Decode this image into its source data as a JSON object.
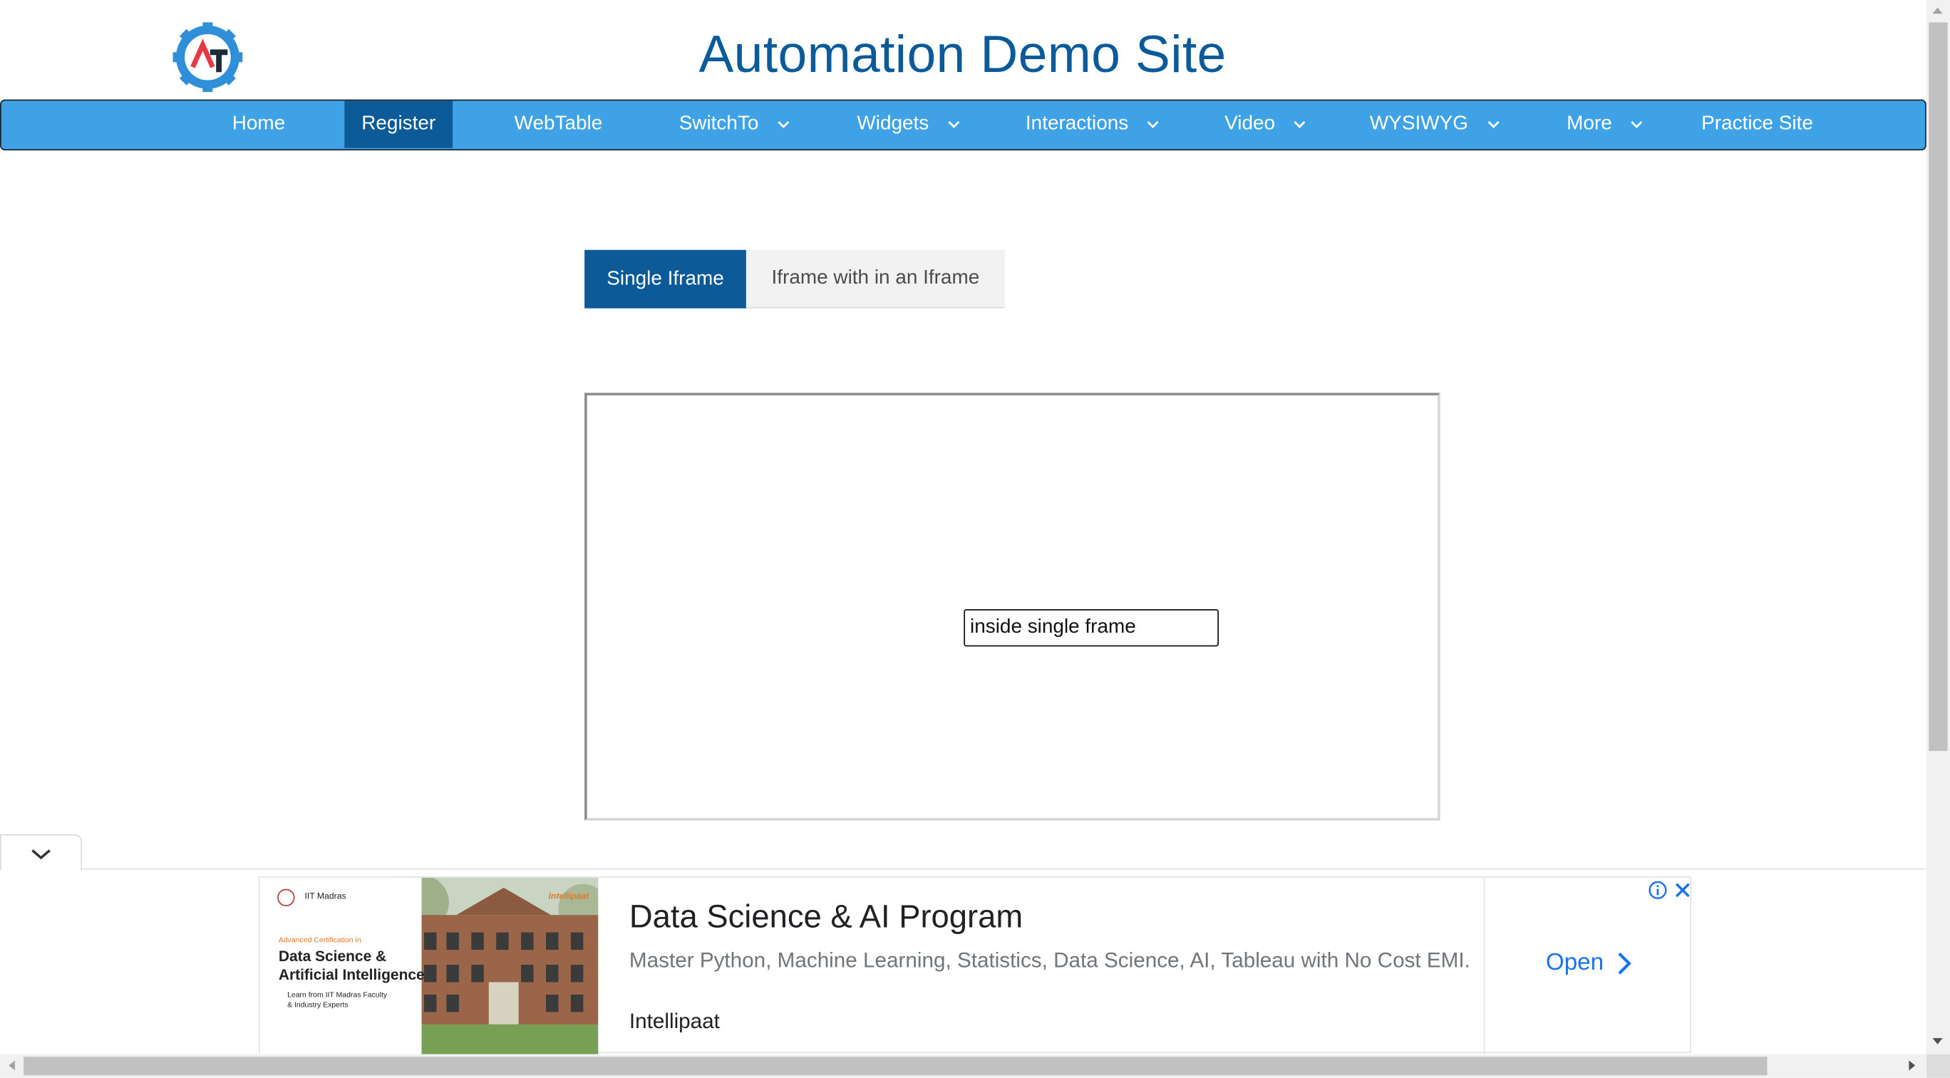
{
  "site": {
    "title": "Automation Demo Site"
  },
  "nav": {
    "items": [
      {
        "label": "Home",
        "dropdown": false,
        "active": false
      },
      {
        "label": "Register",
        "dropdown": false,
        "active": true
      },
      {
        "label": "WebTable",
        "dropdown": false,
        "active": false
      },
      {
        "label": "SwitchTo",
        "dropdown": true,
        "active": false
      },
      {
        "label": "Widgets",
        "dropdown": true,
        "active": false
      },
      {
        "label": "Interactions",
        "dropdown": true,
        "active": false
      },
      {
        "label": "Video",
        "dropdown": true,
        "active": false
      },
      {
        "label": "WYSIWYG",
        "dropdown": true,
        "active": false
      },
      {
        "label": "More",
        "dropdown": true,
        "active": false
      },
      {
        "label": "Practice Site",
        "dropdown": false,
        "active": false
      }
    ]
  },
  "tabs": [
    {
      "label": "Single Iframe",
      "active": true
    },
    {
      "label": "Iframe with in an Iframe",
      "active": false
    }
  ],
  "iframe": {
    "input_value": "inside single frame"
  },
  "ad": {
    "image_text": {
      "institute": "IIT Madras",
      "brand_logo": "Intellipaat",
      "kicker": "Advanced Certification in",
      "title_line1": "Data Science &",
      "title_line2": "Artificial Intelligence",
      "bullet_line1": "Learn from IIT Madras Faculty",
      "bullet_line2": "& Industry Experts"
    },
    "headline": "Data Science & AI Program",
    "description": "Master Python, Machine Learning, Statistics, Data Science, AI, Tableau with No Cost EMI.",
    "advertiser": "Intellipaat",
    "cta": "Open"
  },
  "colors": {
    "primary": "#0c5b98",
    "nav_bg": "#3fa2e6",
    "title": "#0b5a9a",
    "ad_link": "#1a73e8"
  }
}
